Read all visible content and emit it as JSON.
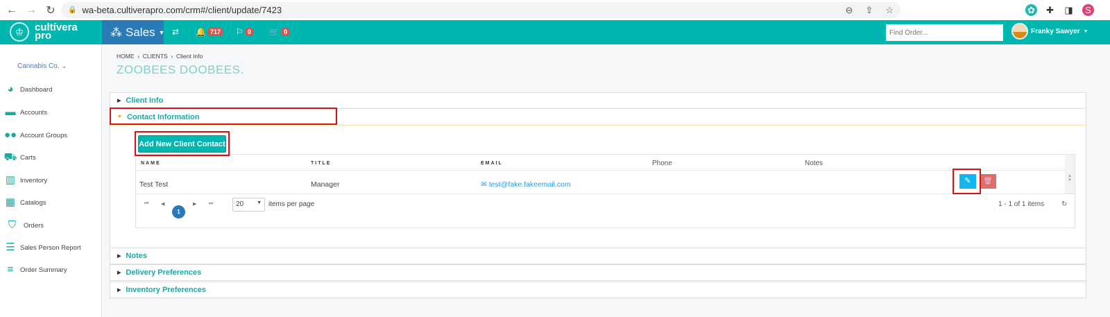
{
  "browser": {
    "url": "wa-beta.cultiverapro.com/crm#/client/update/7423",
    "profile_initial": "S"
  },
  "app": {
    "logo_line1": "cultívera",
    "logo_line2": "pro",
    "module": "Sales",
    "notifications": "717",
    "flags": "0",
    "cart": "0",
    "find_placeholder": "Find Order...",
    "user": "Franky Sawyer"
  },
  "sidebar": {
    "company": "Cannabis Co.",
    "items": [
      {
        "label": "Dashboard",
        "icon": "pie-chart-icon"
      },
      {
        "label": "Accounts",
        "icon": "briefcase-icon"
      },
      {
        "label": "Account Groups",
        "icon": "users-icon"
      },
      {
        "label": "Carts",
        "icon": "cart-icon"
      },
      {
        "label": "Inventory",
        "icon": "barcode-icon"
      },
      {
        "label": "Catalogs",
        "icon": "grid-icon"
      },
      {
        "label": "Orders",
        "icon": "cart-outline-icon"
      },
      {
        "label": "Sales Person Report",
        "icon": "table-icon"
      },
      {
        "label": "Order Summary",
        "icon": "list-icon"
      }
    ]
  },
  "breadcrumb": [
    "HOME",
    "CLIENTS",
    "Client Info"
  ],
  "page_title": "ZOOBEES DOOBEES.",
  "sections": {
    "client_info": "Client Info",
    "contact_info": "Contact Information",
    "notes": "Notes",
    "delivery": "Delivery Preferences",
    "inventory": "Inventory Preferences"
  },
  "contacts": {
    "add_button": "Add New Client Contact",
    "columns": [
      "NAME",
      "TITLE",
      "EMAIL",
      "Phone",
      "Notes"
    ],
    "rows": [
      {
        "name": "Test Test",
        "title": "Manager",
        "email": "test@fake.fakeemail.com",
        "phone": "",
        "notes": ""
      }
    ],
    "page": "1",
    "page_size": "20",
    "items_per_page": "items per page",
    "count": "1 - 1 of 1 items"
  }
}
